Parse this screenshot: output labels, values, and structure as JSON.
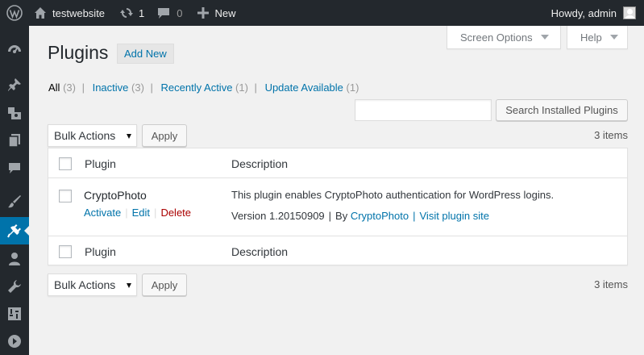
{
  "adminbar": {
    "site_name": "testwebsite",
    "updates_count": "1",
    "comments_count": "0",
    "new_label": "New",
    "howdy": "Howdy, admin"
  },
  "sidebar": {
    "items": [
      {
        "icon": "dashboard-icon"
      },
      {
        "icon": "pushpin-icon"
      },
      {
        "icon": "media-icon"
      },
      {
        "icon": "pages-icon"
      },
      {
        "icon": "comments-icon"
      },
      {
        "icon": "appearance-icon"
      },
      {
        "icon": "plugins-icon",
        "current": true
      },
      {
        "icon": "users-icon"
      },
      {
        "icon": "tools-icon"
      },
      {
        "icon": "settings-icon"
      },
      {
        "icon": "collapse-icon"
      }
    ]
  },
  "screen_meta": {
    "screen_options": "Screen Options",
    "help": "Help"
  },
  "header": {
    "title": "Plugins",
    "add_new": "Add New"
  },
  "filters": [
    {
      "label": "All",
      "count": "(3)",
      "current": true
    },
    {
      "label": "Inactive",
      "count": "(3)"
    },
    {
      "label": "Recently Active",
      "count": "(1)"
    },
    {
      "label": "Update Available",
      "count": "(1)"
    }
  ],
  "search": {
    "value": "",
    "button": "Search Installed Plugins"
  },
  "tablenav": {
    "bulk_actions": "Bulk Actions",
    "apply": "Apply",
    "items_count": "3 items"
  },
  "table": {
    "columns": [
      "Plugin",
      "Description"
    ],
    "rows": [
      {
        "name": "CryptoPhoto",
        "actions": [
          "Activate",
          "Edit",
          "Delete"
        ],
        "description": "This plugin enables CryptoPhoto authentication for WordPress logins.",
        "version": "Version 1.20150909",
        "by": "By",
        "author": "CryptoPhoto",
        "visit": "Visit plugin site"
      }
    ]
  },
  "colors": {
    "adminbar_bg": "#23282d",
    "link": "#0073aa",
    "delete": "#aa0000",
    "current_menu": "#0073aa",
    "page_bg": "#f1f1f1"
  }
}
